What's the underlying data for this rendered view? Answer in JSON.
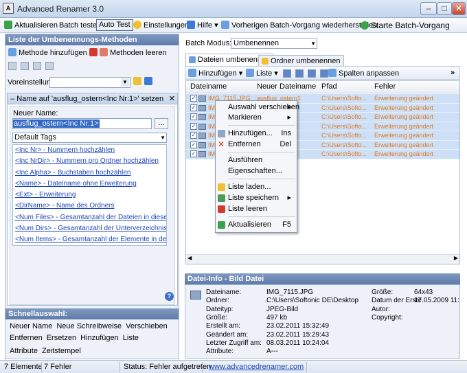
{
  "window": {
    "title": "Advanced Renamer 3.0",
    "app_icon_letter": "A",
    "min": "–",
    "max": "□",
    "close": "✕"
  },
  "toolbar": {
    "refresh": "Aktualisieren",
    "batch_test": "Batch testen",
    "auto_test": "Auto Test",
    "settings": "Einstellungen",
    "help": "Hilfe",
    "restore": "Vorherigen Batch-Vorgang wiederherstellen",
    "start": "Starte Batch-Vorgang"
  },
  "left": {
    "title": "Liste der Umbenennungs-Methoden",
    "add_method": "Methode hinzufügen",
    "clear_methods": "Methoden leeren",
    "presets_label": "Voreinstellungen:",
    "method_header": "Name auf 'ausflug_ostern<Inc Nr:1>' setzen",
    "method_close": "✕",
    "collapse": "–",
    "new_name_label": "Neuer Name:",
    "new_name_value": "ausflug_ostern<Inc Nr:1>",
    "dots": "...",
    "tags_combo": "Default Tags",
    "tags": [
      "<Inc Nr> - Nummern hochzählen",
      "<Inc NrDir> - Nummern pro Ordner hochzählen",
      "<Inc Alpha> - Buchstaben hochzählen",
      "<Name> - Dateiname ohne Erweiterung",
      "<Ext> - Erweiterung",
      "<DirName> - Name des Ordners",
      "<Num Files> - Gesamtanzahl der Dateien in diesem Ordner",
      "<Num Dirs> - Gesamtanzahl der Unterverzeichnisse in dies",
      "<Num Items> - Gesamtanzahl der Elemente in der Liste"
    ],
    "help": "?",
    "quick_title": "Schnellauswahl:",
    "quick_row1": [
      "Neuer Name",
      "Neue Schreibweise",
      "Verschieben"
    ],
    "quick_row2": [
      "Entfernen",
      "Ersetzen",
      "Hinzufügen",
      "Liste"
    ],
    "quick_row3": [
      "Attribute",
      "Zeitstempel"
    ]
  },
  "right": {
    "batch_label": "Batch Modus:",
    "batch_value": "Umbenennen",
    "tab_files": "Dateien umbenennen",
    "tab_folders": "Ordner umbenennen",
    "add": "Hinzufügen",
    "list": "Liste",
    "adjust_columns": "Spalten anpassen",
    "more": "»",
    "columns": [
      "Dateiname",
      "Neuer Dateiname",
      "Pfad",
      "Fehler"
    ],
    "rows": [
      {
        "file": "IMG_7115.JPG",
        "new": "ausflug_ostern1",
        "path": "C:\\Users\\Softo...",
        "error": "Erweiterung geändert"
      },
      {
        "file": "IMG",
        "new": "",
        "path": "C:\\Users\\Softo...",
        "error": "Erweiterung geändert"
      },
      {
        "file": "IMG",
        "new": "",
        "path": "C:\\Users\\Softo...",
        "error": "Erweiterung geändert"
      },
      {
        "file": "IMG",
        "new": "",
        "path": "C:\\Users\\Softo...",
        "error": "Erweiterung geändert"
      },
      {
        "file": "IMG",
        "new": "",
        "path": "C:\\Users\\Softo...",
        "error": "Erweiterung geändert"
      },
      {
        "file": "IMG",
        "new": "",
        "path": "C:\\Users\\Softo...",
        "error": "Erweiterung geändert"
      },
      {
        "file": "IMG",
        "new": "",
        "path": "C:\\Users\\Softo...",
        "error": "Erweiterung geändert"
      }
    ]
  },
  "context_menu": {
    "move_selection": "Auswahl verschieben",
    "mark": "Markieren",
    "add": "Hinzufügen...",
    "add_sc": "Ins",
    "remove": "Entfernen",
    "remove_sc": "Del",
    "execute": "Ausführen",
    "properties": "Eigenschaften...",
    "load_list": "Liste laden...",
    "save_list": "Liste speichern",
    "clear_list": "Liste leeren",
    "refresh": "Aktualisieren",
    "refresh_sc": "F5",
    "submenu_arrow": "▸"
  },
  "info": {
    "title": "Datei-Info - Bild Datei",
    "left_keys": [
      "Dateiname:",
      "Ordner:",
      "Dateityp:",
      "Größe:",
      "Erstellt am:",
      "Geändert am:",
      "Letzter Zugriff am:",
      "Attribute:"
    ],
    "left_vals": [
      "IMG_7115.JPG",
      "C:\\Users\\Softonic DE\\Desktop",
      "JPEG-Bild",
      "497 kb",
      "23.02.2011 15:32:49",
      "23.02.2011 15:29:43",
      "08.03.2011 10:24:04",
      "A---"
    ],
    "right_keys": [
      "Größe:",
      "Datum der Erste",
      "Autor:",
      "Copyright:"
    ],
    "right_vals": [
      "64x43",
      "17.05.2009 11:",
      "",
      ""
    ]
  },
  "status": {
    "items": "7 Elemente",
    "errors": "7 Fehler",
    "state": "Status: Fehler aufgetreten",
    "url": "www.advancedrenamer.com"
  }
}
